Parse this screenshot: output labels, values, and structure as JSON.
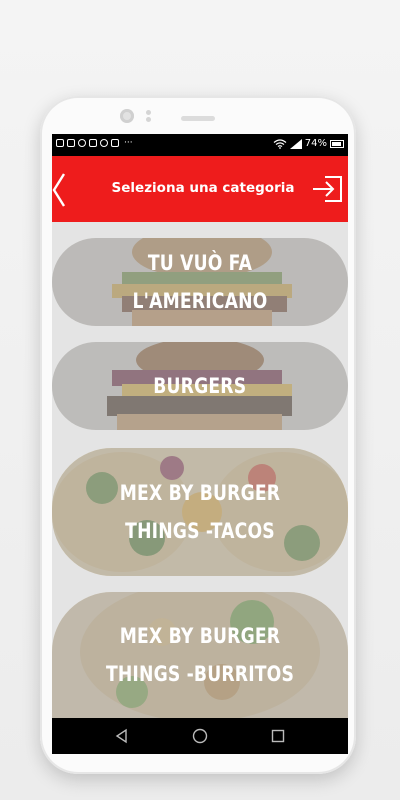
{
  "appbar": {
    "title": "Seleziona una categoria",
    "accent_color": "#ee1c1c"
  },
  "statusbar": {
    "battery": "74%",
    "overflow": "···"
  },
  "categories": [
    {
      "label": "TU VUÒ FA L'AMERICANO",
      "image": "burger-photo"
    },
    {
      "label": "BURGERS",
      "image": "burger-photo"
    },
    {
      "label": "MEX BY BURGER THINGS -TACOS",
      "image": "tacos-photo"
    },
    {
      "label": "MEX BY BURGER THINGS -BURRITOS",
      "image": "burritos-photo"
    }
  ],
  "icons": {
    "back": "chevron-left-icon",
    "login": "login-icon",
    "nav_back": "triangle-back-icon",
    "nav_home": "circle-home-icon",
    "nav_recents": "square-recents-icon"
  }
}
